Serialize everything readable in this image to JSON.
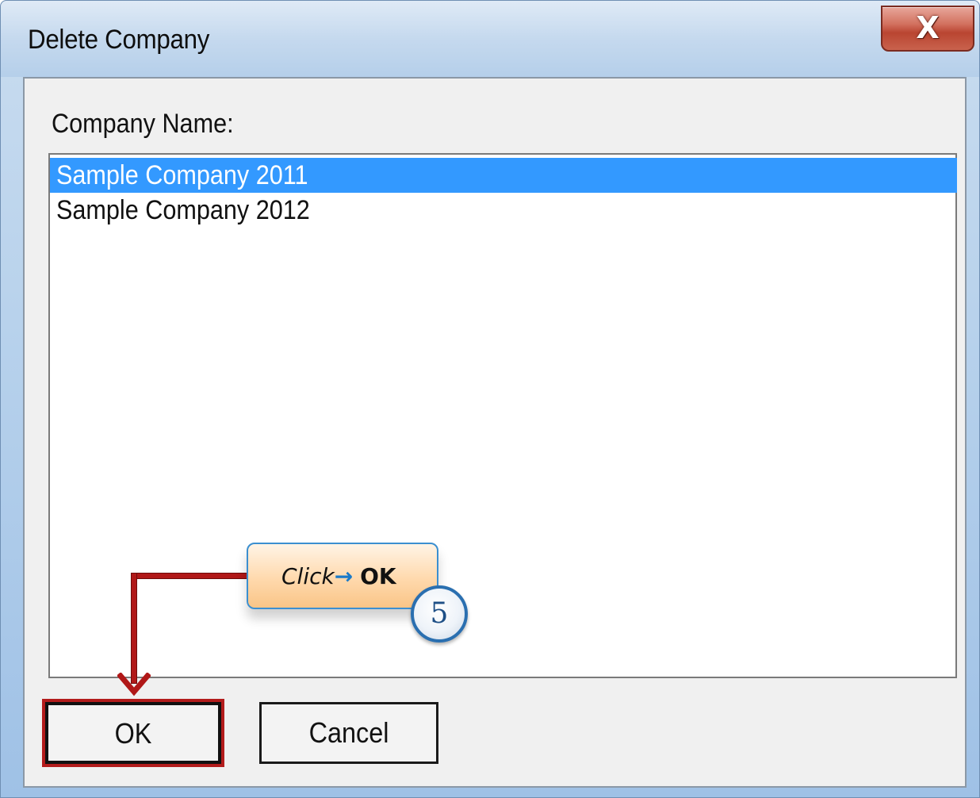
{
  "window": {
    "title": "Delete Company",
    "close_glyph": "X"
  },
  "dialog": {
    "field_label": "Company Name:",
    "companies": [
      {
        "label": "Sample Company 2011",
        "selected": true
      },
      {
        "label": "Sample Company 2012",
        "selected": false
      }
    ],
    "ok_label": "OK",
    "cancel_label": "Cancel"
  },
  "annotation": {
    "click_text": "Click",
    "arrow_glyph": "→",
    "target_text": "OK",
    "step_number": "5",
    "highlight_color": "#b01818",
    "callout_border_color": "#3b8fd0"
  },
  "colors": {
    "selection": "#3399ff",
    "close_button": "#c9624d"
  }
}
